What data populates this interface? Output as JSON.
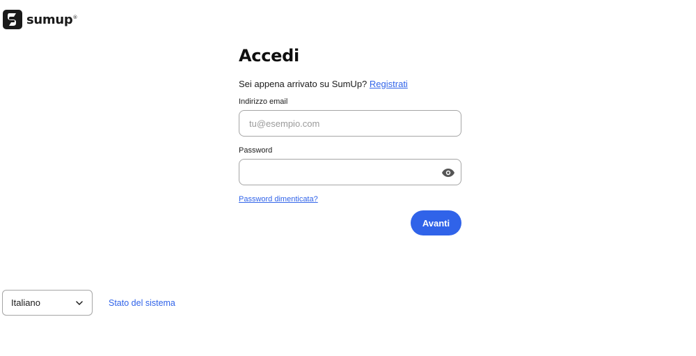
{
  "brand": {
    "name": "sumup",
    "registered_mark": "®"
  },
  "form": {
    "title": "Accedi",
    "signup_prompt": "Sei appena arrivato su SumUp?",
    "signup_link": "Registrati",
    "email_label": "Indirizzo email",
    "email_placeholder": "tu@esempio.com",
    "email_value": "",
    "password_label": "Password",
    "password_value": "",
    "password_toggle_icon": "eye-icon",
    "forgot_link": "Password dimenticata?",
    "submit_label": "Avanti"
  },
  "footer": {
    "language_selected": "Italiano",
    "status_link": "Stato del sistema"
  },
  "colors": {
    "accent": "#3063e9",
    "text": "#1a1a1a",
    "border": "#a5a5a5"
  }
}
